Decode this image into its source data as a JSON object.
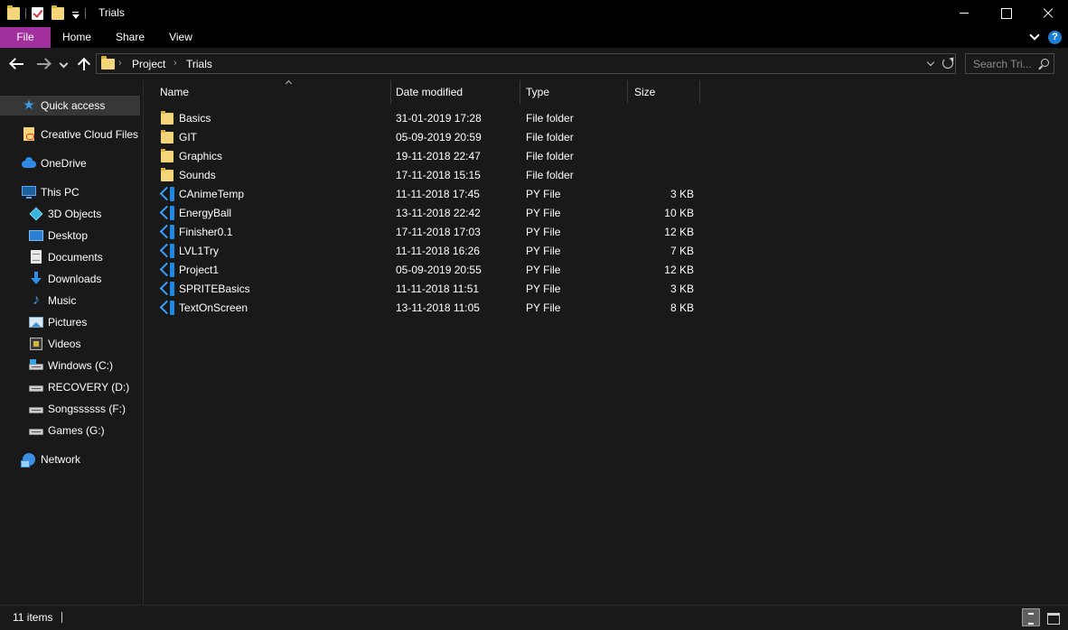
{
  "window": {
    "title": "Trials"
  },
  "ribbon": {
    "file": "File",
    "home": "Home",
    "share": "Share",
    "view": "View",
    "help": "?"
  },
  "address": {
    "crumbs": [
      "Project",
      "Trials"
    ],
    "separator": "›"
  },
  "search": {
    "placeholder": "Search Tri..."
  },
  "sidebar": {
    "items": [
      {
        "label": "Quick access",
        "icon": "star-icon"
      },
      {
        "label": "Creative Cloud Files",
        "icon": "creative-cloud-icon"
      },
      {
        "label": "OneDrive",
        "icon": "cloud-icon"
      },
      {
        "label": "This PC",
        "icon": "computer-icon"
      },
      {
        "label": "3D Objects",
        "icon": "cube-icon"
      },
      {
        "label": "Desktop",
        "icon": "desktop-icon"
      },
      {
        "label": "Documents",
        "icon": "document-icon"
      },
      {
        "label": "Downloads",
        "icon": "download-icon"
      },
      {
        "label": "Music",
        "icon": "music-icon"
      },
      {
        "label": "Pictures",
        "icon": "pictures-icon"
      },
      {
        "label": "Videos",
        "icon": "videos-icon"
      },
      {
        "label": "Windows (C:)",
        "icon": "drive-icon"
      },
      {
        "label": "RECOVERY (D:)",
        "icon": "drive-icon"
      },
      {
        "label": "Songssssss (F:)",
        "icon": "drive-icon"
      },
      {
        "label": "Games (G:)",
        "icon": "drive-icon"
      },
      {
        "label": "Network",
        "icon": "network-icon"
      }
    ]
  },
  "columns": {
    "name": "Name",
    "date": "Date modified",
    "type": "Type",
    "size": "Size"
  },
  "files": [
    {
      "name": "Basics",
      "date": "31-01-2019 17:28",
      "type": "File folder",
      "size": "",
      "icon": "folder-icon"
    },
    {
      "name": "GIT",
      "date": "05-09-2019 20:59",
      "type": "File folder",
      "size": "",
      "icon": "folder-icon"
    },
    {
      "name": "Graphics",
      "date": "19-11-2018 22:47",
      "type": "File folder",
      "size": "",
      "icon": "folder-icon"
    },
    {
      "name": "Sounds",
      "date": "17-11-2018 15:15",
      "type": "File folder",
      "size": "",
      "icon": "folder-icon"
    },
    {
      "name": "CAnimeTemp",
      "date": "11-11-2018 17:45",
      "type": "PY File",
      "size": "3 KB",
      "icon": "vscode-file-icon"
    },
    {
      "name": "EnergyBall",
      "date": "13-11-2018 22:42",
      "type": "PY File",
      "size": "10 KB",
      "icon": "vscode-file-icon"
    },
    {
      "name": "Finisher0.1",
      "date": "17-11-2018 17:03",
      "type": "PY File",
      "size": "12 KB",
      "icon": "vscode-file-icon"
    },
    {
      "name": "LVL1Try",
      "date": "11-11-2018 16:26",
      "type": "PY File",
      "size": "7 KB",
      "icon": "vscode-file-icon"
    },
    {
      "name": "Project1",
      "date": "05-09-2019 20:55",
      "type": "PY File",
      "size": "12 KB",
      "icon": "vscode-file-icon"
    },
    {
      "name": "SPRITEBasics",
      "date": "11-11-2018 11:51",
      "type": "PY File",
      "size": "3 KB",
      "icon": "vscode-file-icon"
    },
    {
      "name": "TextOnScreen",
      "date": "13-11-2018 11:05",
      "type": "PY File",
      "size": "8 KB",
      "icon": "vscode-file-icon"
    }
  ],
  "status": {
    "count": "11 items"
  },
  "colors": {
    "file_tab": "#a12f9e",
    "background": "#191919",
    "titlebar": "#000000",
    "folder": "#f4d579",
    "accent": "#1d7fd4"
  }
}
